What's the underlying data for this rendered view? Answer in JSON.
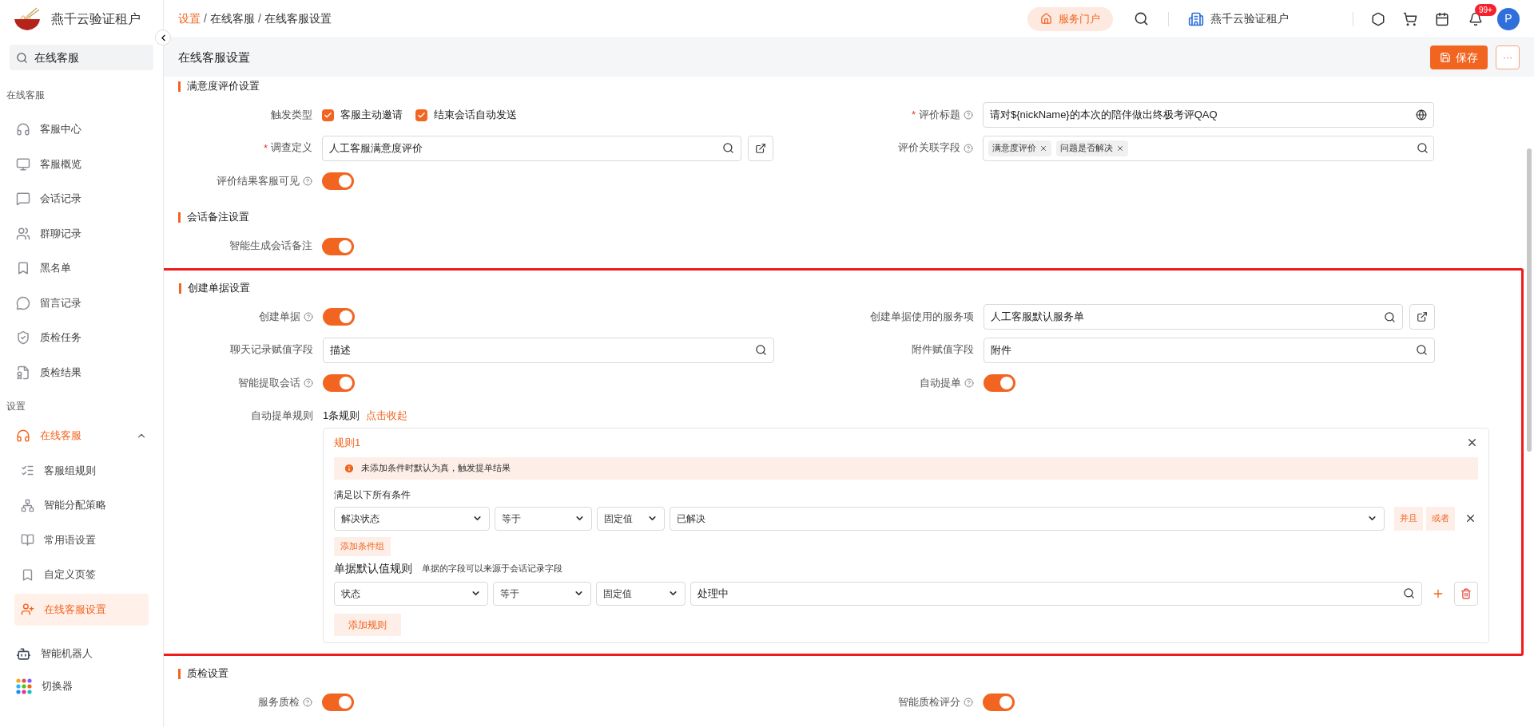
{
  "sidebar": {
    "tenant": "燕千云验证租户",
    "search": {
      "value": "在线客服"
    },
    "groups": [
      {
        "title": "在线客服",
        "items": [
          {
            "label": "客服中心",
            "selected": false
          },
          {
            "label": "客服概览",
            "selected": false
          },
          {
            "label": "会话记录",
            "selected": false
          },
          {
            "label": "群聊记录",
            "selected": false
          },
          {
            "label": "黑名单",
            "selected": false
          },
          {
            "label": "留言记录",
            "selected": false
          },
          {
            "label": "质检任务",
            "selected": false
          },
          {
            "label": "质检结果",
            "selected": false
          }
        ]
      },
      {
        "title": "设置",
        "items": [
          {
            "label": "在线客服",
            "selected": false,
            "expanded": true,
            "children": [
              {
                "label": "客服组规则",
                "selected": false
              },
              {
                "label": "智能分配策略",
                "selected": false
              },
              {
                "label": "常用语设置",
                "selected": false
              },
              {
                "label": "自定义页签",
                "selected": false
              },
              {
                "label": "在线客服设置",
                "selected": true
              }
            ]
          }
        ]
      }
    ],
    "footer_items": [
      {
        "label": "智能机器人"
      },
      {
        "label": "切换器"
      }
    ]
  },
  "header": {
    "breadcrumb": [
      {
        "label": "设置",
        "link": true
      },
      {
        "label": "在线客服",
        "link": false
      },
      {
        "label": "在线客服设置",
        "link": false
      }
    ],
    "separator": "/",
    "portal_button": "服务门户",
    "tenant": "燕千云验证租户",
    "notification_badge": "99+",
    "avatar": "P"
  },
  "page": {
    "title": "在线客服设置",
    "save_button": "保存",
    "more_button": "···"
  },
  "sections": [
    {
      "title": "满意度评价设置",
      "highlighted": false,
      "rows": [
        {
          "fields": [
            {
              "label": "触发类型",
              "kind": "checkboxes",
              "options": [
                {
                  "label": "客服主动邀请",
                  "checked": true
                },
                {
                  "label": "结束会话自动发送",
                  "checked": true
                }
              ]
            },
            {
              "label": "评价标题",
              "mark": "*",
              "help": true,
              "kind": "text",
              "value": "请对${nickName}的本次的陪伴做出终极考评QAQ"
            }
          ]
        },
        {
          "fields": [
            {
              "label": "调查定义",
              "mark": "*",
              "kind": "lookup",
              "value": "人工客服满意度评价",
              "link": true
            },
            {
              "label": "评价关联字段",
              "help": true,
              "kind": "tags",
              "tags": [
                "满意度评价",
                "问题是否解决"
              ]
            }
          ]
        },
        {
          "fields": [
            {
              "label": "评价结果客服可见",
              "help": true,
              "kind": "switch",
              "on": true
            }
          ]
        }
      ]
    },
    {
      "title": "会话备注设置",
      "highlighted": false,
      "rows": [
        {
          "fields": [
            {
              "label": "智能生成会话备注",
              "kind": "switch",
              "on": true
            }
          ]
        }
      ]
    },
    {
      "title": "创建单据设置",
      "highlighted": true,
      "rows": [
        {
          "fields": [
            {
              "label": "创建单据",
              "help": true,
              "kind": "switch",
              "on": true
            },
            {
              "label": "创建单据使用的服务项",
              "kind": "lookup",
              "value": "人工客服默认服务单",
              "link": true
            }
          ]
        },
        {
          "fields": [
            {
              "label": "聊天记录赋值字段",
              "kind": "lookup",
              "value": "描述",
              "link": false
            },
            {
              "label": "附件赋值字段",
              "kind": "lookup",
              "value": "附件",
              "link": false
            }
          ]
        },
        {
          "fields": [
            {
              "label": "智能提取会话",
              "help": true,
              "kind": "switch",
              "on": true
            },
            {
              "label": "自动提单",
              "help": true,
              "kind": "switch",
              "on": true
            }
          ]
        },
        {
          "fields": [
            {
              "label": "自动提单规则",
              "kind": "rules",
              "count": "1条规则",
              "toggle": "点击收起",
              "rule": {
                "title": "规则1",
                "notice": "未添加条件时默认为真，触发提单结果",
                "conditions_title": "满足以下所有条件",
                "conditions": [
                  {
                    "field": "解决状态",
                    "operator": "等于",
                    "type": "固定值",
                    "value": "已解决"
                  }
                ],
                "logic": [
                  "并且",
                  "或者"
                ],
                "add_condition": "添加条件组",
                "defaults_title": "单据默认值规则",
                "defaults_hint": "单据的字段可以来源于会话记录字段",
                "defaults": [
                  {
                    "field": "状态",
                    "operator": "等于",
                    "type": "固定值",
                    "value": "处理中"
                  }
                ],
                "add_rule": "添加规则"
              }
            }
          ]
        }
      ]
    },
    {
      "title": "质检设置",
      "highlighted": false,
      "rows": [
        {
          "fields": [
            {
              "label": "服务质检",
              "help": true,
              "kind": "switch",
              "on": true
            },
            {
              "label": "智能质检评分",
              "help": true,
              "kind": "switch",
              "on": true
            }
          ]
        }
      ]
    }
  ]
}
